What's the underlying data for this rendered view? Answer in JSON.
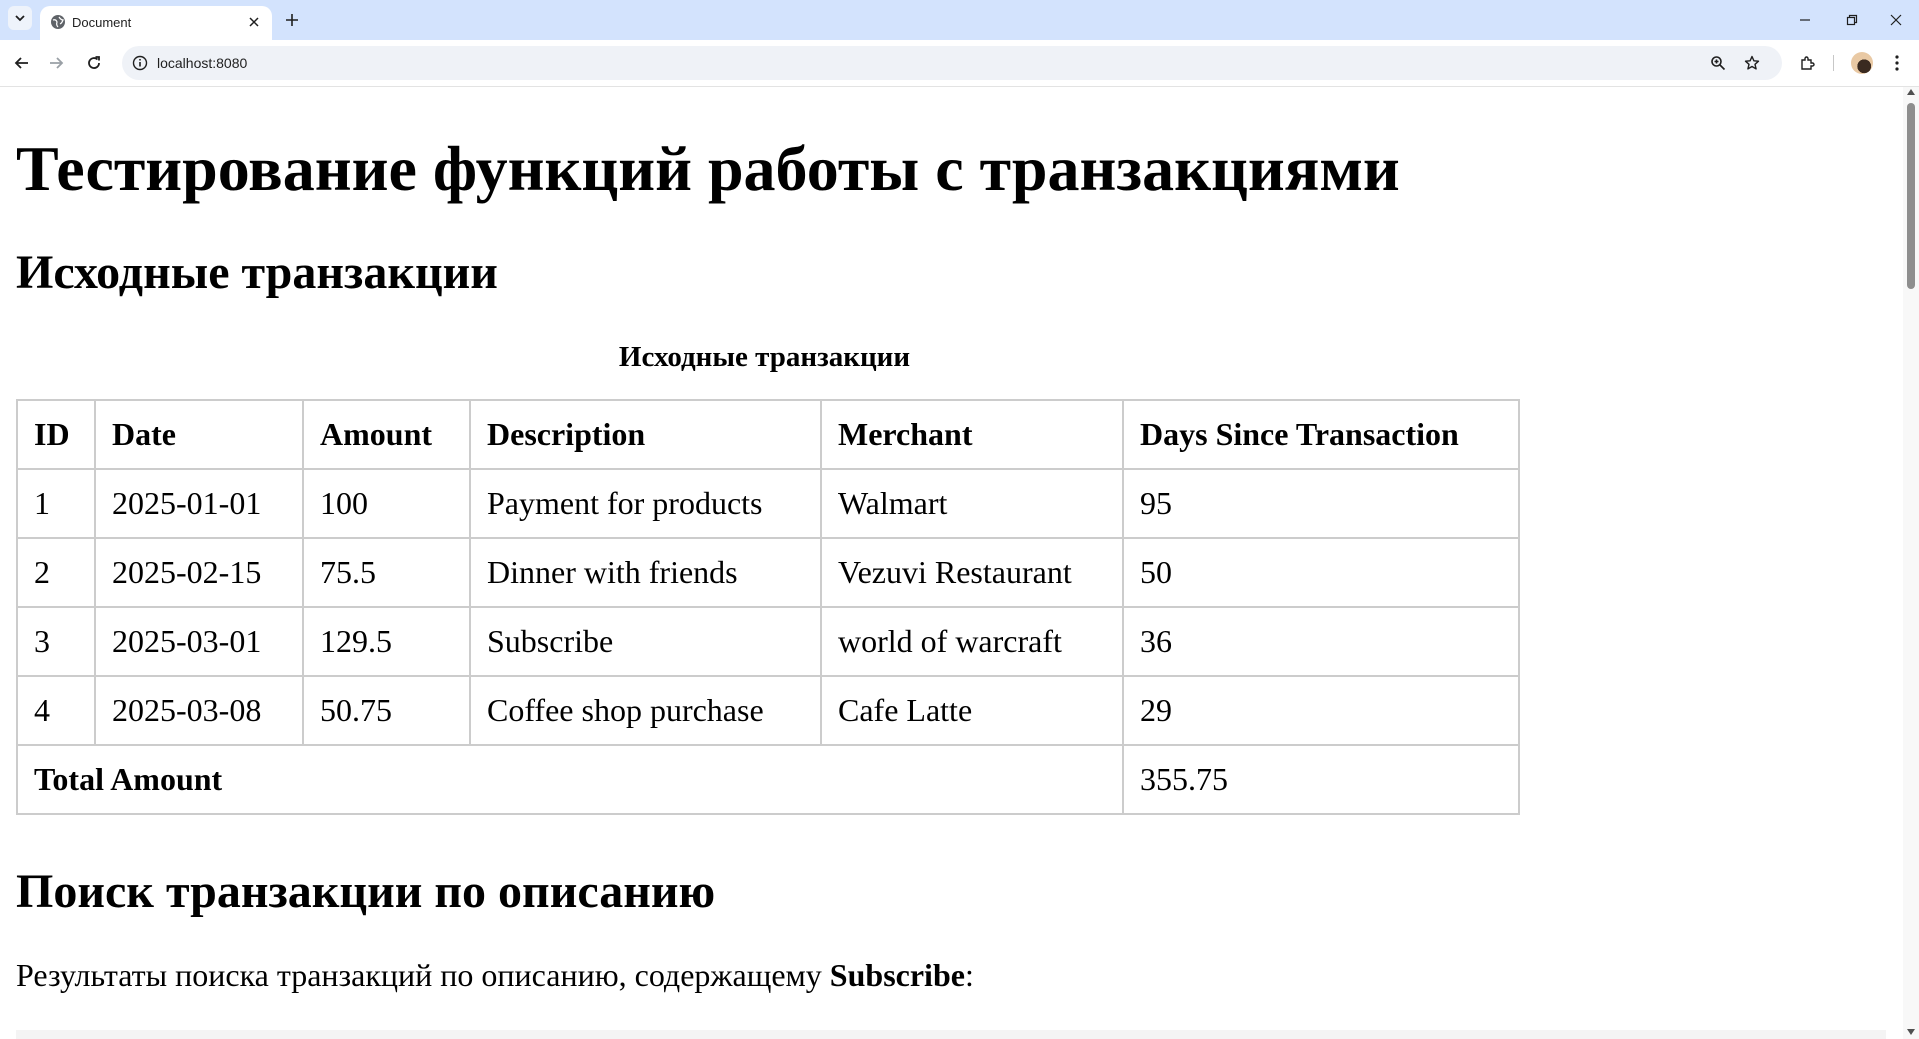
{
  "browser": {
    "tab_title": "Document",
    "url": "localhost:8080"
  },
  "page": {
    "title": "Тестирование функций работы с транзакциями",
    "section1_heading": "Исходные транзакции",
    "table_caption": "Исходные транзакции",
    "table": {
      "headers": [
        "ID",
        "Date",
        "Amount",
        "Description",
        "Merchant",
        "Days Since Transaction"
      ],
      "rows": [
        [
          "1",
          "2025-01-01",
          "100",
          "Payment for products",
          "Walmart",
          "95"
        ],
        [
          "2",
          "2025-02-15",
          "75.5",
          "Dinner with friends",
          "Vezuvi Restaurant",
          "50"
        ],
        [
          "3",
          "2025-03-01",
          "129.5",
          "Subscribe",
          "world of warcraft",
          "36"
        ],
        [
          "4",
          "2025-03-08",
          "50.75",
          "Coffee shop purchase",
          "Cafe Latte",
          "29"
        ]
      ],
      "total_label": "Total Amount",
      "total_value": "355.75"
    },
    "section2_heading": "Поиск транзакции по описанию",
    "search_text": "Результаты поиска транзакций по описанию, содержащему ",
    "search_term": "Subscribe",
    "search_suffix": ":"
  }
}
